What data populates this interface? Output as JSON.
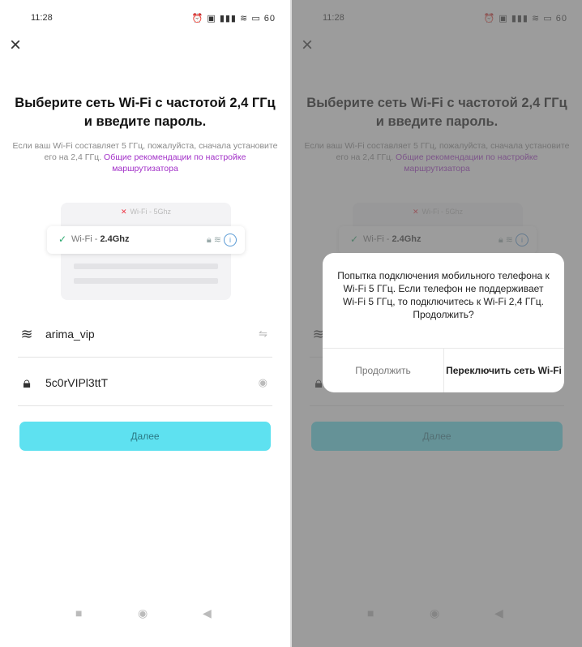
{
  "status_time": "11:28",
  "status_icons": "⏰ ▣ ▮▮▮ ≋ ▭ 60",
  "close_glyph": "×",
  "title": "Выберите сеть Wi-Fi с частотой 2,4 ГГц и введите пароль.",
  "desc_text": "Если ваш Wi-Fi составляет 5 ГГц, пожалуйста, сначала установите его на 2,4 ГГц. ",
  "desc_link": "Общие рекомендации по настройке маршрутизатора",
  "illustration": {
    "row_bad": "Wi-Fi - 5Ghz",
    "row_good_prefix": "Wi-Fi - ",
    "row_good_band": "2.4Ghz",
    "info_glyph": "i"
  },
  "ssid": "arima_vip",
  "password": "5c0rVIPl3ttT",
  "next_button": "Далее",
  "dialog": {
    "message": "Попытка подключения мобильного телефона к Wi-Fi 5 ГГц. Если телефон не поддерживает Wi-Fi 5 ГГц, то подключитесь к Wi-Fi 2,4 ГГц. Продолжить?",
    "continue_label": "Продолжить",
    "switch_label": "Переключить сеть Wi-Fi"
  },
  "nav": {
    "recents": "■",
    "home": "◉",
    "back": "◀"
  }
}
